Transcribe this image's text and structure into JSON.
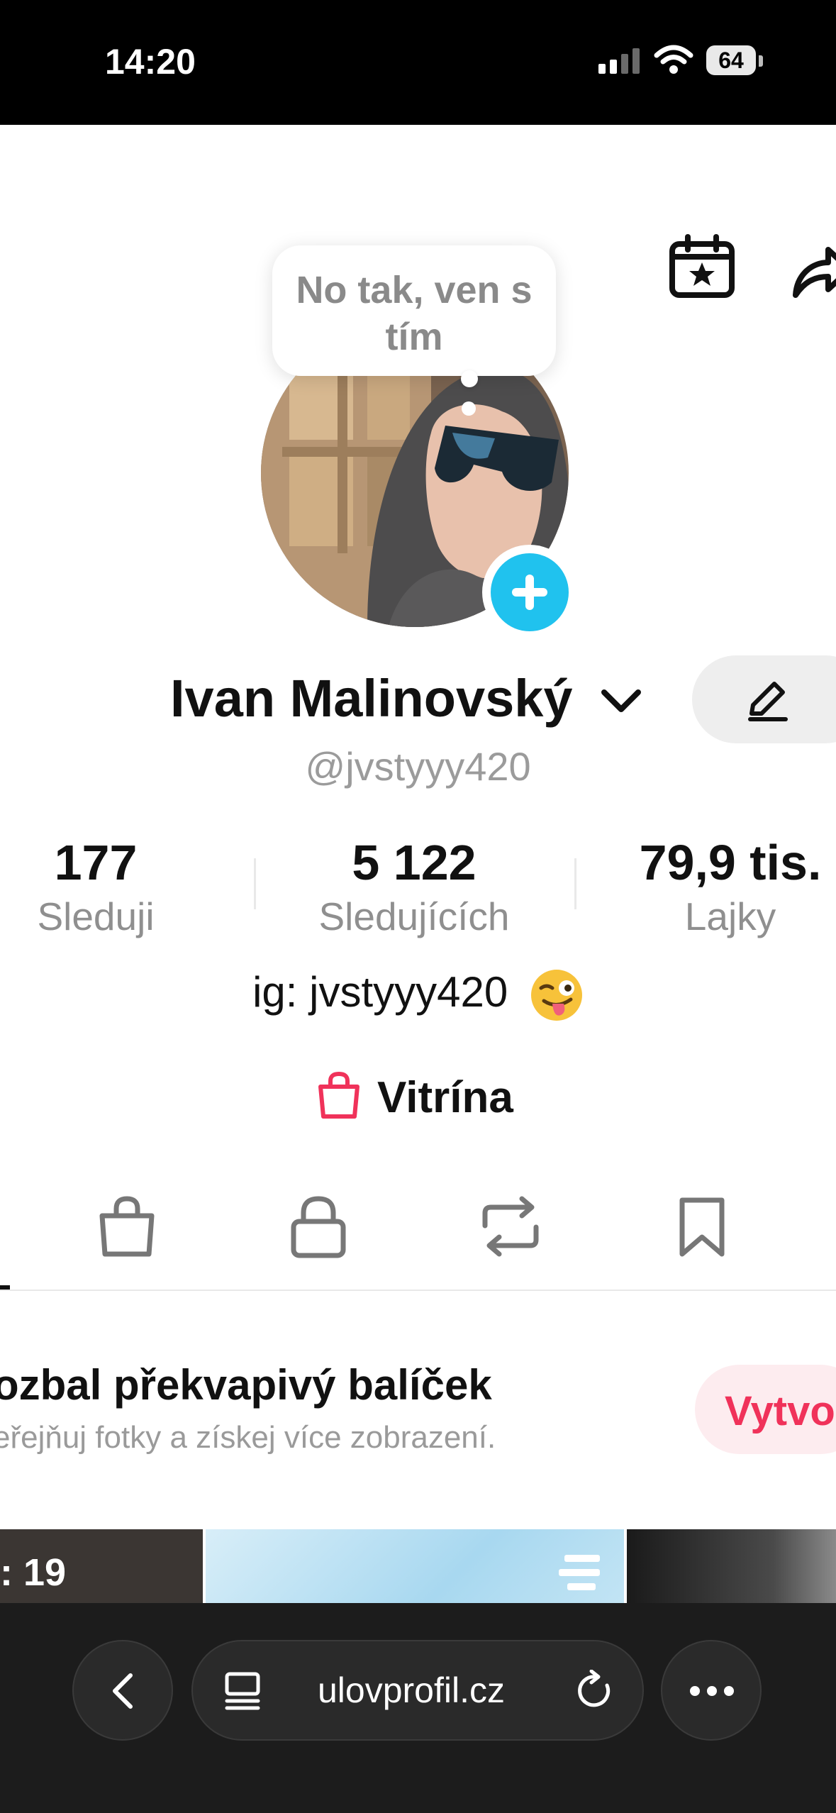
{
  "status_bar": {
    "time": "14:20",
    "battery": "64"
  },
  "speech_bubble": {
    "text": "No tak, ven s tím"
  },
  "profile": {
    "name": "Ivan Malinovský",
    "handle": "@jvstyyy420",
    "bio": "ig: jvstyyy420",
    "bio_emoji": "winking-face-with-tongue"
  },
  "stats": [
    {
      "value": "177",
      "label": "Sleduji"
    },
    {
      "value": "5 122",
      "label": "Sledujících"
    },
    {
      "value": "79,9 tis.",
      "label": "Lajky"
    }
  ],
  "showcase": {
    "label": "Vitrína",
    "color": "#f0325a"
  },
  "tabs": [
    "shopping-bag-icon",
    "lock-icon",
    "repost-icon",
    "bookmark-icon"
  ],
  "promo": {
    "title": "ozbal překvapivý balíček",
    "subtitle": "eřejňuj fotky a získej více zobrazení.",
    "button_label": "Vytvo"
  },
  "thumbnails": [
    {
      "overlay_text": ": 19"
    }
  ],
  "browser": {
    "url": "ulovprofil.cz"
  },
  "colors": {
    "accent_blue": "#20c2ee",
    "accent_pink": "#f0325a"
  }
}
